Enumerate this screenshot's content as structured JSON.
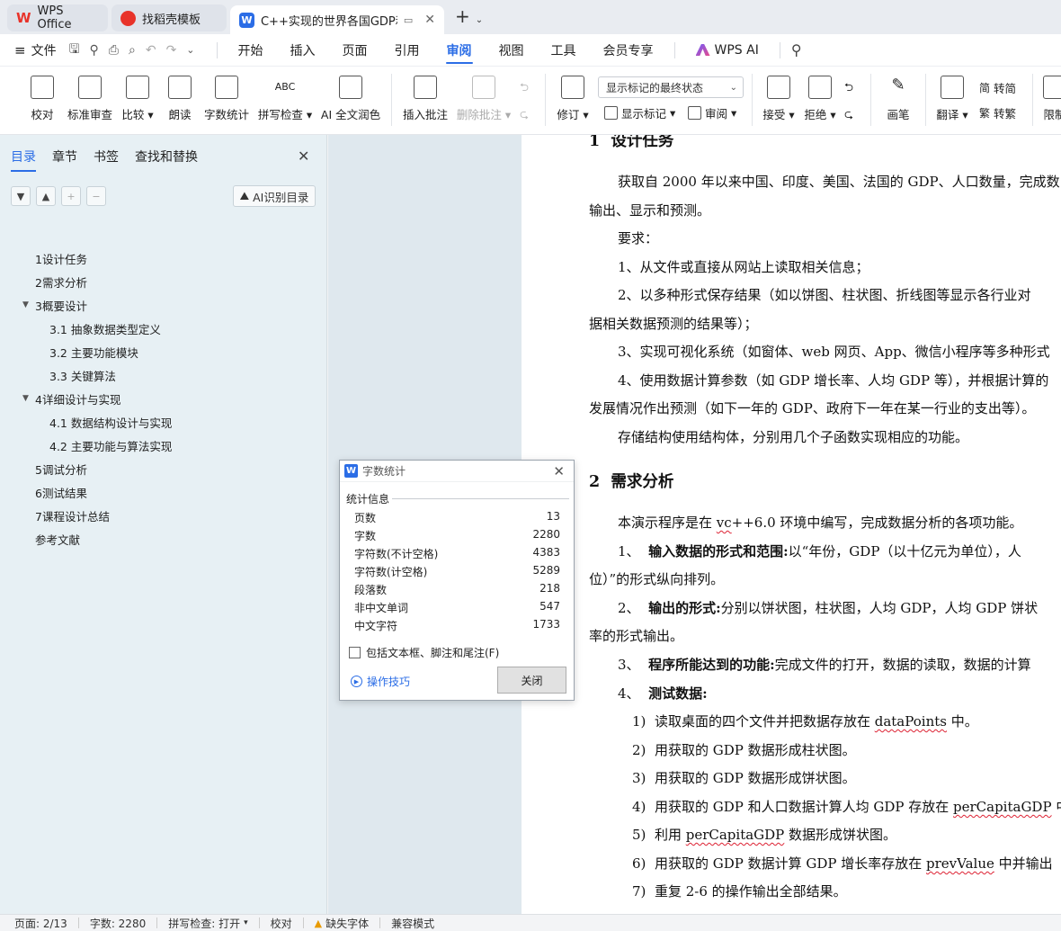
{
  "tabs": [
    {
      "label": "WPS Office",
      "icon": "wps-logo-icon"
    },
    {
      "label": "找稻壳模板",
      "icon": "template-icon"
    },
    {
      "label": "C++实现的世界各国GDP和人",
      "icon": "writer-doc-icon"
    }
  ],
  "menu": {
    "file": "文件",
    "items": [
      "开始",
      "插入",
      "页面",
      "引用",
      "审阅",
      "视图",
      "工具",
      "会员专享"
    ],
    "active": "审阅",
    "ai": "WPS AI"
  },
  "ribbon": {
    "proofread": "校对",
    "standard_review": "标准审查",
    "compare": "比较",
    "read_aloud": "朗读",
    "word_count": "字数统计",
    "spell_check": "拼写检查",
    "ai_polish": "AI 全文润色",
    "insert_comment": "插入批注",
    "delete_comment": "删除批注",
    "track_changes": "修订",
    "markup_display": "显示标记的最终状态",
    "show_markup": "显示标记",
    "review": "审阅",
    "accept": "接受",
    "reject": "拒绝",
    "ink": "画笔",
    "translate": "翻译",
    "to_simplified": "转简",
    "to_traditional": "转繁",
    "restrict": "限制"
  },
  "nav": {
    "tabs": [
      "目录",
      "章节",
      "书签",
      "查找和替换"
    ],
    "ai_toc": "AI识别目录",
    "toc": [
      {
        "label": "1设计任务",
        "level": 1,
        "expandable": false
      },
      {
        "label": "2需求分析",
        "level": 1,
        "expandable": false
      },
      {
        "label": "3概要设计",
        "level": 1,
        "expandable": true
      },
      {
        "label": "3.1 抽象数据类型定义",
        "level": 2,
        "expandable": false
      },
      {
        "label": "3.2  主要功能模块",
        "level": 2,
        "expandable": false
      },
      {
        "label": "3.3  关键算法",
        "level": 2,
        "expandable": false
      },
      {
        "label": "4详细设计与实现",
        "level": 1,
        "expandable": true
      },
      {
        "label": "4.1  数据结构设计与实现",
        "level": 2,
        "expandable": false
      },
      {
        "label": "4.2  主要功能与算法实现",
        "level": 2,
        "expandable": false
      },
      {
        "label": "5调试分析",
        "level": 1,
        "expandable": false
      },
      {
        "label": "6测试结果",
        "level": 1,
        "expandable": false
      },
      {
        "label": "7课程设计总结",
        "level": 1,
        "expandable": false
      },
      {
        "label": "参考文献",
        "level": 1,
        "expandable": false
      }
    ]
  },
  "doc": {
    "h1_num": "1",
    "h1": "设计任务",
    "p1a": "获取自 2000 年以来中国、印度、美国、法国的 GDP、人口数量，完成数",
    "p1b": "输出、显示和预测。",
    "req": "要求：",
    "r1": "1、从文件或直接从网站上读取相关信息；",
    "r2a": "2、以多种形式保存结果（如以饼图、柱状图、折线图等显示各行业对",
    "r2b": "据相关数据预测的结果等）；",
    "r3": "3、实现可视化系统（如窗体、web 网页、App、微信小程序等多种形式",
    "r4a": "4、使用数据计算参数（如 GDP 增长率、人均 GDP 等），并根据计算的",
    "r4b": "发展情况作出预测（如下一年的 GDP、政府下一年在某一行业的支出等）。",
    "store": "存储结构使用结构体，分别用几个子函数实现相应的功能。",
    "h2_num": "2",
    "h2": "需求分析",
    "intro_a": "本演示程序是在 ",
    "intro_vc": "vc",
    "intro_b": "++6.0 环境中编写，完成数据分析的各项功能。",
    "i1_num": "1、",
    "i1_bold": "输入数据的形式和范围:",
    "i1_text": "以“年份，GDP（以十亿元为单位），人",
    "i1_cont": "位）”的形式纵向排列。",
    "i2_num": "2、",
    "i2_bold": "输出的形式:",
    "i2_text": "分别以饼状图，柱状图，人均 GDP，人均 GDP 饼状",
    "i2_cont": "率的形式输出。",
    "i3_num": "3、",
    "i3_bold": "程序所能达到的功能:",
    "i3_text": "完成文件的打开，数据的读取，数据的计算",
    "i4_num": "4、",
    "i4_bold": "测试数据:",
    "t1_num": "1)",
    "t1a": "读取桌面的四个文件并把数据存放在 ",
    "t1w": "dataPoints",
    "t1b": " 中。",
    "t2_num": "2)",
    "t2": "用获取的 GDP 数据形成柱状图。",
    "t3_num": "3)",
    "t3": "用获取的 GDP 数据形成饼状图。",
    "t4_num": "4)",
    "t4a": "用获取的 GDP 和人口数据计算人均 GDP 存放在 ",
    "t4w": "perCapitaGDP",
    "t4b": " 中",
    "t5_num": "5)",
    "t5a": "利用 ",
    "t5w": "perCapitaGDP",
    "t5b": " 数据形成饼状图。",
    "t6_num": "6)",
    "t6a": "用获取的 GDP 数据计算 GDP 增长率存放在 ",
    "t6w": "prevValue",
    "t6b": " 中并输出",
    "t7_num": "7)",
    "t7": "重复 2-6 的操作输出全部结果。"
  },
  "dialog": {
    "title": "字数统计",
    "section": "统计信息",
    "stats": [
      {
        "label": "页数",
        "value": "13"
      },
      {
        "label": "字数",
        "value": "2280"
      },
      {
        "label": "字符数(不计空格)",
        "value": "4383"
      },
      {
        "label": "字符数(计空格)",
        "value": "5289"
      },
      {
        "label": "段落数",
        "value": "218"
      },
      {
        "label": "非中文单词",
        "value": "547"
      },
      {
        "label": "中文字符",
        "value": "1733"
      }
    ],
    "include_label": "包括文本框、脚注和尾注(F)",
    "include_checked": false,
    "tips": "操作技巧",
    "close": "关闭"
  },
  "status": {
    "page": "页面: 2/13",
    "words": "字数: 2280",
    "spell": "拼写检查: 打开",
    "proof": "校对",
    "missing_font": "缺失字体",
    "compat": "兼容模式"
  }
}
